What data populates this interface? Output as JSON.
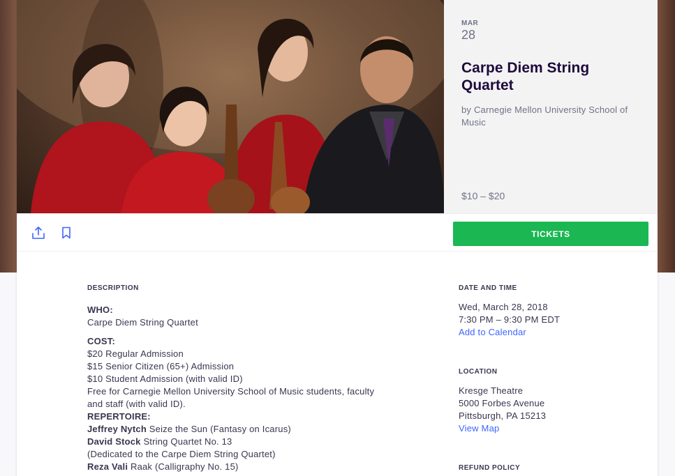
{
  "hero": {
    "month": "MAR",
    "day": "28",
    "title": "Carpe Diem String Quartet",
    "organizer": "by Carnegie Mellon University School of Music",
    "price": "$10 – $20"
  },
  "actions": {
    "share_icon": "share-icon",
    "save_icon": "bookmark-icon",
    "tickets_label": "TICKETS"
  },
  "description": {
    "heading": "DESCRIPTION",
    "who_label": "WHO:",
    "who_value": "Carpe Diem String Quartet",
    "cost_label": "COST:",
    "cost_lines": [
      "$20 Regular Admission",
      "$15 Senior Citizen (65+) Admission",
      "$10 Student Admission (with valid ID)",
      "Free for Carnegie Mellon University School of Music students, faculty and staff (with valid ID)."
    ],
    "repertoire_label": "REPERTOIRE:",
    "repertoire": [
      {
        "composer": "Jeffrey Nytch",
        "work": "Seize the Sun (Fantasy on Icarus)"
      },
      {
        "composer": "David Stock",
        "work": "String Quartet No. 13"
      },
      {
        "composer": "",
        "work": "(Dedicated to the Carpe Diem String Quartet)"
      },
      {
        "composer": "Reza Vali",
        "work": "Raak (Calligraphy No. 15)"
      }
    ]
  },
  "date_time": {
    "heading": "DATE AND TIME",
    "date": "Wed, March 28, 2018",
    "time": "7:30 PM – 9:30 PM EDT",
    "calendar_link": "Add to Calendar"
  },
  "location": {
    "heading": "LOCATION",
    "venue": "Kresge Theatre",
    "street": "5000 Forbes Avenue",
    "city": "Pittsburgh, PA 15213",
    "map_link": "View Map"
  },
  "refund": {
    "heading": "REFUND POLICY"
  },
  "colors": {
    "accent_green": "#1bb752",
    "link_blue": "#3d64ff",
    "title": "#1e0a3c"
  }
}
